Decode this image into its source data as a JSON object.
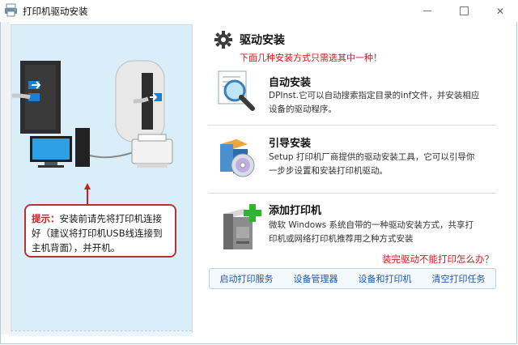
{
  "window": {
    "title": "打印机驱动安装",
    "min_label": "",
    "max_label": "",
    "close_label": "✕"
  },
  "left": {
    "tip_label": "提示：",
    "tip_text": "安装前请先将打印机连接好（建议将打印机USB线连接到主机背面），并开机。"
  },
  "header": {
    "title": "驱动安装",
    "subtitle": "下面几种安装方式只需选其中一种！"
  },
  "options": [
    {
      "title": "自动安装",
      "desc": "DPInst.它可以自动搜索指定目录的inf文件，并安装相应设备的驱动程序。",
      "icon": "magnifier-icon"
    },
    {
      "title": "引导安装",
      "desc": "Setup 打印机厂商提供的驱动安装工具，它可以引导你一步步设置和安装打印机驱动。",
      "icon": "setup-disc-icon"
    },
    {
      "title": "添加打印机",
      "desc": "微软 Windows 系统自带的一种驱动安装方式，共享打印机或网络打印机推荐用之种方式安装",
      "icon": "add-printer-icon"
    }
  ],
  "help_link": "装完驱动不能打印怎么办？",
  "bottom_links": [
    "启动打印服务",
    "设备管理器",
    "设备和打印机",
    "清空打印任务"
  ],
  "colors": {
    "accent_red": "#d21414",
    "link_blue": "#1f56a6",
    "panel_bg": "#daeef9"
  }
}
